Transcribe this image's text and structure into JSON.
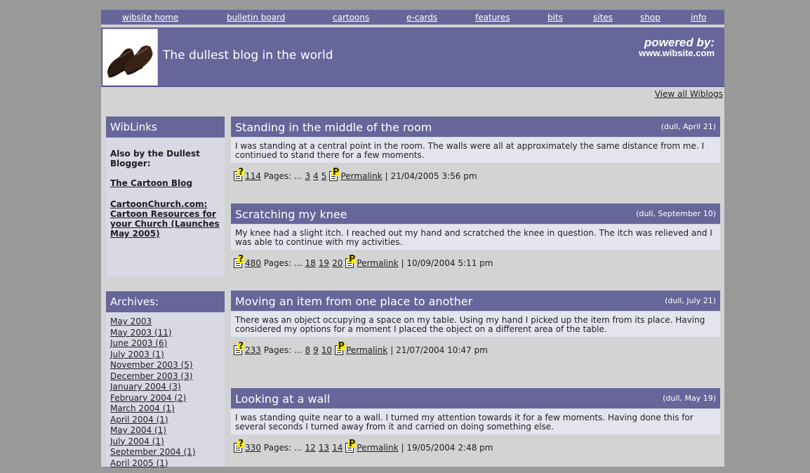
{
  "nav": [
    "wibsite home",
    "bulletin board",
    "cartoons",
    "e-cards",
    "features",
    "bits",
    "sites",
    "shop",
    "info"
  ],
  "banner": {
    "title": "The dullest blog in the world",
    "powered_line1": "powered by:",
    "powered_line2": "www.wibsite.com"
  },
  "view_all": "View all Wiblogs",
  "wiblinks": {
    "heading": "WibLinks",
    "also_label": "Also by the Dullest Blogger:",
    "links": [
      "The Cartoon Blog ",
      "CartoonChurch.com: Cartoon Resources for your Church (Launches May 2005) "
    ]
  },
  "archives": {
    "heading": "Archives:",
    "items": [
      "May 2003",
      "May 2003 (11)",
      "June 2003 (6)",
      "July 2003 (1)",
      "November 2003 (5)",
      "December 2003 (3)",
      "January 2004 (3)",
      "February 2004 (2)",
      "March 2004 (1)",
      "April 2004 (1)",
      "May 2004 (1)",
      "July 2004 (1)",
      "September 2004 (1)",
      "April 2005 (1)"
    ]
  },
  "posts": [
    {
      "title": "Standing in the middle of the room",
      "meta": "(dull, April 21)",
      "body": "I was standing at a central point in the room. The walls were all at approximately the same distance from me. I continued to stand there for a few moments.",
      "comments": "114",
      "pages_label": "Pages: ...",
      "pages": [
        "3",
        "4",
        "5"
      ],
      "permalink": "Permalink",
      "timestamp": "| 21/04/2005 3:56 pm"
    },
    {
      "title": "Scratching my knee",
      "meta": "(dull, September 10)",
      "body": "My knee had a slight itch. I reached out my hand and scratched the knee in question. The itch was relieved and I was able to continue with my activities.",
      "comments": "480",
      "pages_label": "Pages: ...",
      "pages": [
        "18",
        "19",
        "20"
      ],
      "permalink": "Permalink",
      "timestamp": "| 10/09/2004 5:11 pm"
    },
    {
      "title": "Moving an item from one place to another",
      "meta": "(dull, July 21)",
      "body": "There was an object occupying a space on my table. Using my hand I picked up the item from its place. Having considered my options for a moment I placed the object on a different area of the table.",
      "comments": "233",
      "pages_label": "Pages: ...",
      "pages": [
        "8",
        "9",
        "10"
      ],
      "permalink": "Permalink",
      "timestamp": "| 21/07/2004 10:47 pm"
    },
    {
      "title": "Looking at a wall",
      "meta": "(dull, May 19)",
      "body": "I was standing quite near to a wall. I turned my attention towards it for a few moments. Having done this for several seconds I turned away from it and carried on doing something else.",
      "comments": "330",
      "pages_label": "Pages: ...",
      "pages": [
        "12",
        "13",
        "14"
      ],
      "permalink": "Permalink",
      "timestamp": "| 19/05/2004 2:48 pm"
    }
  ],
  "icons": {
    "comment": "comment-icon",
    "permalink": "permalink-icon",
    "logo": "shoes-logo"
  }
}
